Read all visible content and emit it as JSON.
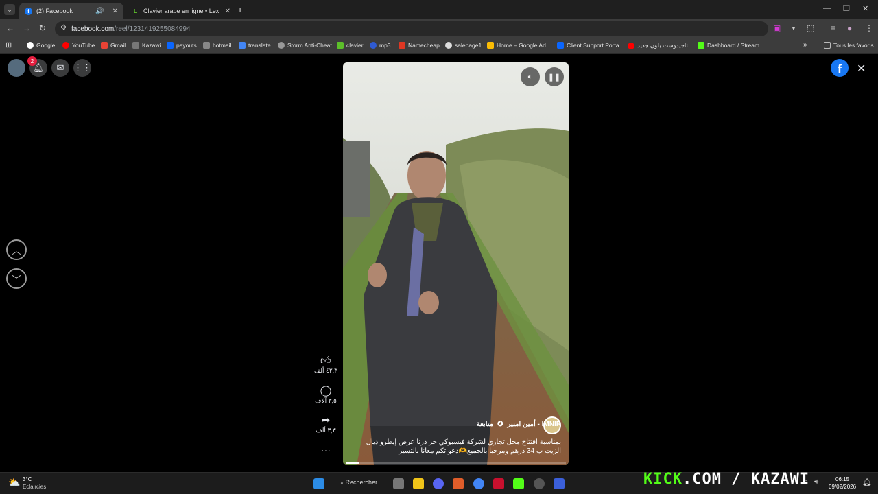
{
  "browser": {
    "tabs": [
      {
        "title": "(2) Facebook",
        "active": true
      },
      {
        "title": "Clavier arabe en ligne • Lexilogos",
        "active": false
      }
    ],
    "url_host": "facebook.com",
    "url_path": "/reel/1231419255084994",
    "bookmarks": [
      "Google",
      "YouTube",
      "Gmail",
      "Kazawi",
      "payouts",
      "hotmail",
      "translate",
      "Storm Anti-Cheat",
      "clavier",
      "mp3",
      "Namecheap",
      "salepage1",
      "Home – Google Ad...",
      "Client Support Porta...",
      "تاجيدوست بلون جديد...",
      "Dashboard / Stream..."
    ],
    "all_bookmarks": "Tous les favoris"
  },
  "facebook": {
    "notification_count": "2",
    "reel": {
      "author": "IMNIR - أمين امنير",
      "follow": "متابعة",
      "caption": "بمناسبة افتتاح محل تجاري لشركة فيسبوكي حر درنا عرض إيطرو ديال الزيت ب 34 درهم ومرحبا بالجميع🫶دعواتكم معانا بالتسير",
      "likes": "٤٢,٣ ألف",
      "comments": "٣,٥ آلاف",
      "shares": "٣,٣ ألف",
      "progress": 0.06
    }
  },
  "taskbar": {
    "weather_temp": "3°C",
    "weather_desc": "Eclaircies",
    "search": "Rechercher",
    "time": "06:15",
    "date": "09/02/2026"
  },
  "overlay": {
    "kick_green": "KICK",
    "kick_rest": ".COM / KAZAWI"
  }
}
